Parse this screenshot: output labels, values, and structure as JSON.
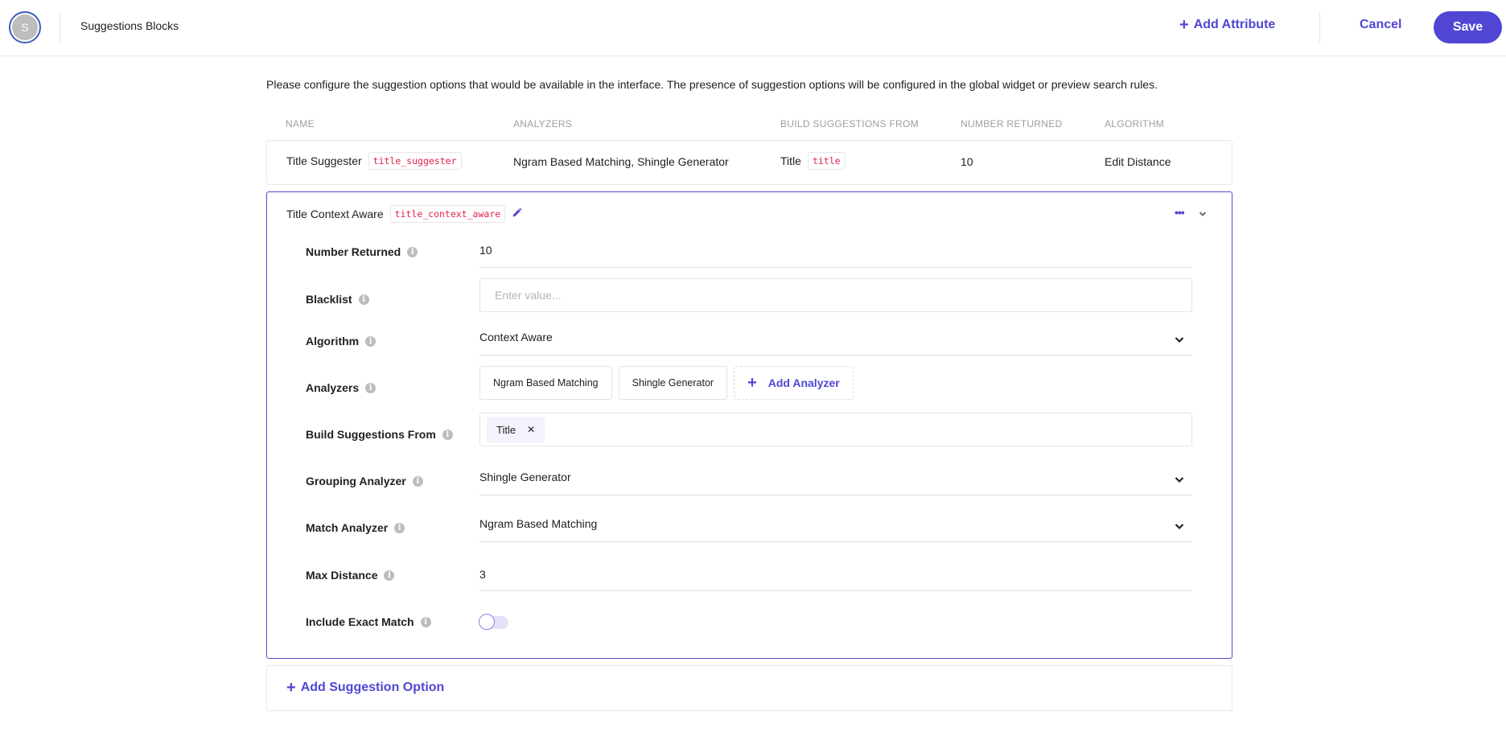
{
  "header": {
    "avatar_initial": "S",
    "title": "Suggestions Blocks",
    "add_attribute_label": "Add Attribute",
    "cancel_label": "Cancel",
    "save_label": "Save"
  },
  "intro_text": "Please configure the suggestion options that would be available in the interface. The presence of suggestion options will be configured in the global widget or preview search rules.",
  "table": {
    "columns": [
      "NAME",
      "ANALYZERS",
      "BUILD SUGGESTIONS FROM",
      "NUMBER RETURNED",
      "ALGORITHM"
    ],
    "rows": [
      {
        "name": "Title Suggester",
        "name_key": "title_suggester",
        "analyzers": "Ngram Based Matching, Shingle Generator",
        "build_from": "Title",
        "build_from_key": "title",
        "number_returned": "10",
        "algorithm": "Edit Distance"
      }
    ]
  },
  "expanded": {
    "name": "Title Context Aware",
    "name_key": "title_context_aware",
    "icons": {
      "edit": "pencil-icon",
      "more": "ellipsis-icon",
      "collapse": "chevron-down-icon"
    },
    "fields": {
      "number_returned": {
        "label": "Number Returned",
        "value": "10"
      },
      "blacklist": {
        "label": "Blacklist",
        "value": "",
        "placeholder": "Enter value..."
      },
      "algorithm": {
        "label": "Algorithm",
        "value": "Context Aware"
      },
      "analyzers": {
        "label": "Analyzers",
        "items": [
          "Ngram Based Matching",
          "Shingle Generator"
        ],
        "add_label": "Add Analyzer"
      },
      "build_from": {
        "label": "Build Suggestions From",
        "tags": [
          "Title"
        ]
      },
      "grouping_analyzer": {
        "label": "Grouping Analyzer",
        "value": "Shingle Generator"
      },
      "match_analyzer": {
        "label": "Match Analyzer",
        "value": "Ngram Based Matching"
      },
      "max_distance": {
        "label": "Max Distance",
        "value": "3"
      },
      "include_exact_match": {
        "label": "Include Exact Match",
        "enabled": false
      }
    }
  },
  "add_option_label": "Add Suggestion Option",
  "colors": {
    "accent": "#5046d3",
    "code": "#e0244a",
    "muted": "#9e9e9e"
  }
}
